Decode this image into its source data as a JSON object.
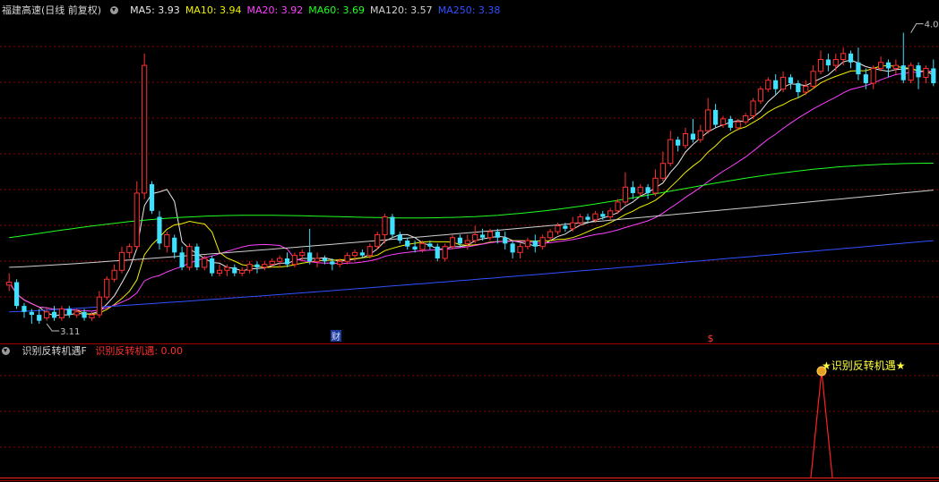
{
  "main_header": {
    "title": "福建高速(日线 前复权)",
    "ma": [
      {
        "label": "MA5: 3.93",
        "color": "#e8e8e8"
      },
      {
        "label": "MA10: 3.94",
        "color": "#f0f000"
      },
      {
        "label": "MA20: 3.92",
        "color": "#ff40ff"
      },
      {
        "label": "MA60: 3.69",
        "color": "#20ff20"
      },
      {
        "label": "MA120: 3.57",
        "color": "#d0d0d0"
      },
      {
        "label": "MA250: 3.38",
        "color": "#3050ff"
      }
    ]
  },
  "indicator_header": {
    "name": "识别反转机遇F",
    "value_label": "识别反转机遇: 0.00",
    "value_color": "#ff3030"
  },
  "markers": {
    "cai": "财",
    "dollar": "$",
    "signal_text": "★识别反转机遇★"
  },
  "colors": {
    "up": "#ff3030",
    "down": "#40e0ff",
    "grid": "#8a0000",
    "frame": "#a00000",
    "signal_text": "#ffff40",
    "signal_line": "#ff2020"
  },
  "chart_data": {
    "type": "candlestick",
    "ylim": [
      3.08,
      4.14
    ],
    "price_annotations": [
      {
        "label": "3.11",
        "value": 3.11,
        "index": 5
      },
      {
        "label": "4.09",
        "value": 4.09,
        "index": 120
      }
    ],
    "candles": [
      [
        3.24,
        3.25,
        3.22,
        3.28
      ],
      [
        3.25,
        3.17,
        3.16,
        3.26
      ],
      [
        3.17,
        3.15,
        3.13,
        3.18
      ],
      [
        3.15,
        3.14,
        3.11,
        3.16
      ],
      [
        3.14,
        3.12,
        3.11,
        3.16
      ],
      [
        3.13,
        3.15,
        3.12,
        3.16
      ],
      [
        3.15,
        3.13,
        3.12,
        3.17
      ],
      [
        3.13,
        3.16,
        3.12,
        3.17
      ],
      [
        3.16,
        3.14,
        3.13,
        3.17
      ],
      [
        3.14,
        3.15,
        3.13,
        3.16
      ],
      [
        3.15,
        3.13,
        3.12,
        3.16
      ],
      [
        3.13,
        3.14,
        3.12,
        3.15
      ],
      [
        3.14,
        3.2,
        3.13,
        3.22
      ],
      [
        3.2,
        3.26,
        3.19,
        3.27
      ],
      [
        3.26,
        3.29,
        3.25,
        3.31
      ],
      [
        3.29,
        3.35,
        3.28,
        3.37
      ],
      [
        3.35,
        3.37,
        3.33,
        3.38
      ],
      [
        3.37,
        3.55,
        3.36,
        3.59
      ],
      [
        3.55,
        3.98,
        3.53,
        4.02
      ],
      [
        3.58,
        3.49,
        3.48,
        3.59
      ],
      [
        3.47,
        3.38,
        3.36,
        3.49
      ],
      [
        3.37,
        3.41,
        3.35,
        3.42
      ],
      [
        3.4,
        3.35,
        3.33,
        3.41
      ],
      [
        3.35,
        3.3,
        3.29,
        3.37
      ],
      [
        3.3,
        3.37,
        3.29,
        3.38
      ],
      [
        3.37,
        3.3,
        3.29,
        3.38
      ],
      [
        3.3,
        3.33,
        3.29,
        3.34
      ],
      [
        3.33,
        3.28,
        3.27,
        3.34
      ],
      [
        3.28,
        3.29,
        3.27,
        3.31
      ],
      [
        3.29,
        3.3,
        3.27,
        3.31
      ],
      [
        3.3,
        3.28,
        3.27,
        3.31
      ],
      [
        3.28,
        3.29,
        3.27,
        3.3
      ],
      [
        3.29,
        3.31,
        3.28,
        3.32
      ],
      [
        3.31,
        3.3,
        3.28,
        3.32
      ],
      [
        3.3,
        3.31,
        3.29,
        3.32
      ],
      [
        3.31,
        3.32,
        3.3,
        3.33
      ],
      [
        3.32,
        3.33,
        3.3,
        3.34
      ],
      [
        3.33,
        3.31,
        3.3,
        3.35
      ],
      [
        3.31,
        3.34,
        3.3,
        3.35
      ],
      [
        3.34,
        3.35,
        3.32,
        3.36
      ],
      [
        3.35,
        3.32,
        3.31,
        3.43
      ],
      [
        3.32,
        3.33,
        3.3,
        3.35
      ],
      [
        3.33,
        3.32,
        3.31,
        3.34
      ],
      [
        3.32,
        3.31,
        3.29,
        3.33
      ],
      [
        3.31,
        3.32,
        3.3,
        3.33
      ],
      [
        3.32,
        3.34,
        3.31,
        3.35
      ],
      [
        3.34,
        3.35,
        3.32,
        3.36
      ],
      [
        3.35,
        3.34,
        3.33,
        3.36
      ],
      [
        3.34,
        3.37,
        3.33,
        3.38
      ],
      [
        3.37,
        3.41,
        3.36,
        3.42
      ],
      [
        3.41,
        3.47,
        3.38,
        3.48
      ],
      [
        3.47,
        3.41,
        3.4,
        3.48
      ],
      [
        3.41,
        3.39,
        3.38,
        3.42
      ],
      [
        3.39,
        3.37,
        3.36,
        3.4
      ],
      [
        3.37,
        3.36,
        3.35,
        3.39
      ],
      [
        3.36,
        3.38,
        3.35,
        3.39
      ],
      [
        3.38,
        3.37,
        3.36,
        3.39
      ],
      [
        3.37,
        3.33,
        3.32,
        3.38
      ],
      [
        3.33,
        3.37,
        3.32,
        3.38
      ],
      [
        3.37,
        3.4,
        3.36,
        3.41
      ],
      [
        3.4,
        3.38,
        3.37,
        3.41
      ],
      [
        3.38,
        3.39,
        3.36,
        3.41
      ],
      [
        3.39,
        3.41,
        3.38,
        3.44
      ],
      [
        3.41,
        3.4,
        3.39,
        3.43
      ],
      [
        3.4,
        3.42,
        3.39,
        3.43
      ],
      [
        3.42,
        3.4,
        3.38,
        3.43
      ],
      [
        3.4,
        3.38,
        3.36,
        3.42
      ],
      [
        3.38,
        3.35,
        3.33,
        3.39
      ],
      [
        3.35,
        3.37,
        3.33,
        3.38
      ],
      [
        3.37,
        3.39,
        3.36,
        3.4
      ],
      [
        3.39,
        3.37,
        3.35,
        3.41
      ],
      [
        3.37,
        3.4,
        3.36,
        3.41
      ],
      [
        3.4,
        3.42,
        3.39,
        3.43
      ],
      [
        3.42,
        3.44,
        3.41,
        3.45
      ],
      [
        3.44,
        3.43,
        3.42,
        3.45
      ],
      [
        3.43,
        3.45,
        3.42,
        3.47
      ],
      [
        3.45,
        3.47,
        3.44,
        3.48
      ],
      [
        3.47,
        3.46,
        3.45,
        3.48
      ],
      [
        3.46,
        3.48,
        3.45,
        3.49
      ],
      [
        3.48,
        3.47,
        3.46,
        3.49
      ],
      [
        3.47,
        3.49,
        3.46,
        3.5
      ],
      [
        3.49,
        3.52,
        3.48,
        3.53
      ],
      [
        3.52,
        3.57,
        3.51,
        3.62
      ],
      [
        3.57,
        3.55,
        3.53,
        3.59
      ],
      [
        3.55,
        3.57,
        3.54,
        3.58
      ],
      [
        3.57,
        3.55,
        3.53,
        3.58
      ],
      [
        3.55,
        3.6,
        3.54,
        3.63
      ],
      [
        3.6,
        3.65,
        3.59,
        3.69
      ],
      [
        3.65,
        3.73,
        3.64,
        3.76
      ],
      [
        3.73,
        3.71,
        3.69,
        3.74
      ],
      [
        3.71,
        3.75,
        3.7,
        3.77
      ],
      [
        3.75,
        3.73,
        3.72,
        3.8
      ],
      [
        3.73,
        3.76,
        3.72,
        3.78
      ],
      [
        3.76,
        3.83,
        3.75,
        3.87
      ],
      [
        3.83,
        3.78,
        3.77,
        3.85
      ],
      [
        3.78,
        3.8,
        3.77,
        3.81
      ],
      [
        3.8,
        3.77,
        3.76,
        3.81
      ],
      [
        3.77,
        3.79,
        3.76,
        3.8
      ],
      [
        3.79,
        3.81,
        3.78,
        3.82
      ],
      [
        3.81,
        3.86,
        3.8,
        3.87
      ],
      [
        3.86,
        3.9,
        3.85,
        3.91
      ],
      [
        3.9,
        3.93,
        3.89,
        3.94
      ],
      [
        3.93,
        3.9,
        3.88,
        3.95
      ],
      [
        3.9,
        3.94,
        3.89,
        3.96
      ],
      [
        3.94,
        3.92,
        3.9,
        3.95
      ],
      [
        3.92,
        3.89,
        3.87,
        3.93
      ],
      [
        3.89,
        3.91,
        3.88,
        3.93
      ],
      [
        3.91,
        3.96,
        3.9,
        3.98
      ],
      [
        3.96,
        4.0,
        3.95,
        4.03
      ],
      [
        4.0,
        3.98,
        3.96,
        4.02
      ],
      [
        3.98,
        4.0,
        3.96,
        4.02
      ],
      [
        4.0,
        4.02,
        3.98,
        4.04
      ],
      [
        4.02,
        3.99,
        3.97,
        4.03
      ],
      [
        3.99,
        3.95,
        3.93,
        4.04
      ],
      [
        3.95,
        3.92,
        3.9,
        3.97
      ],
      [
        3.92,
        3.97,
        3.9,
        3.98
      ],
      [
        3.97,
        3.99,
        3.96,
        4.01
      ],
      [
        3.99,
        3.97,
        3.94,
        4.0
      ],
      [
        3.97,
        3.98,
        3.95,
        4.0
      ],
      [
        3.98,
        3.93,
        3.92,
        4.09
      ],
      [
        3.93,
        3.98,
        3.92,
        3.99
      ],
      [
        3.98,
        3.94,
        3.9,
        3.99
      ],
      [
        3.94,
        3.97,
        3.92,
        3.98
      ],
      [
        3.97,
        3.92,
        3.91,
        4.0
      ]
    ],
    "ma_periods": [
      5,
      10,
      20,
      60,
      120,
      250
    ],
    "ma_colors": [
      "#e8e8e8",
      "#f0f000",
      "#ff40ff",
      "#20ff20",
      "#d0d0d0",
      "#3050ff"
    ],
    "ma60_endpoints": [
      3.4,
      3.63
    ],
    "ma120_endpoints": [
      3.3,
      3.56
    ],
    "ma250_endpoints": [
      3.15,
      3.39
    ],
    "indicator": {
      "ylim": [
        0,
        1
      ],
      "values_nonzero": [
        {
          "index": 108,
          "value": 1
        }
      ]
    }
  }
}
